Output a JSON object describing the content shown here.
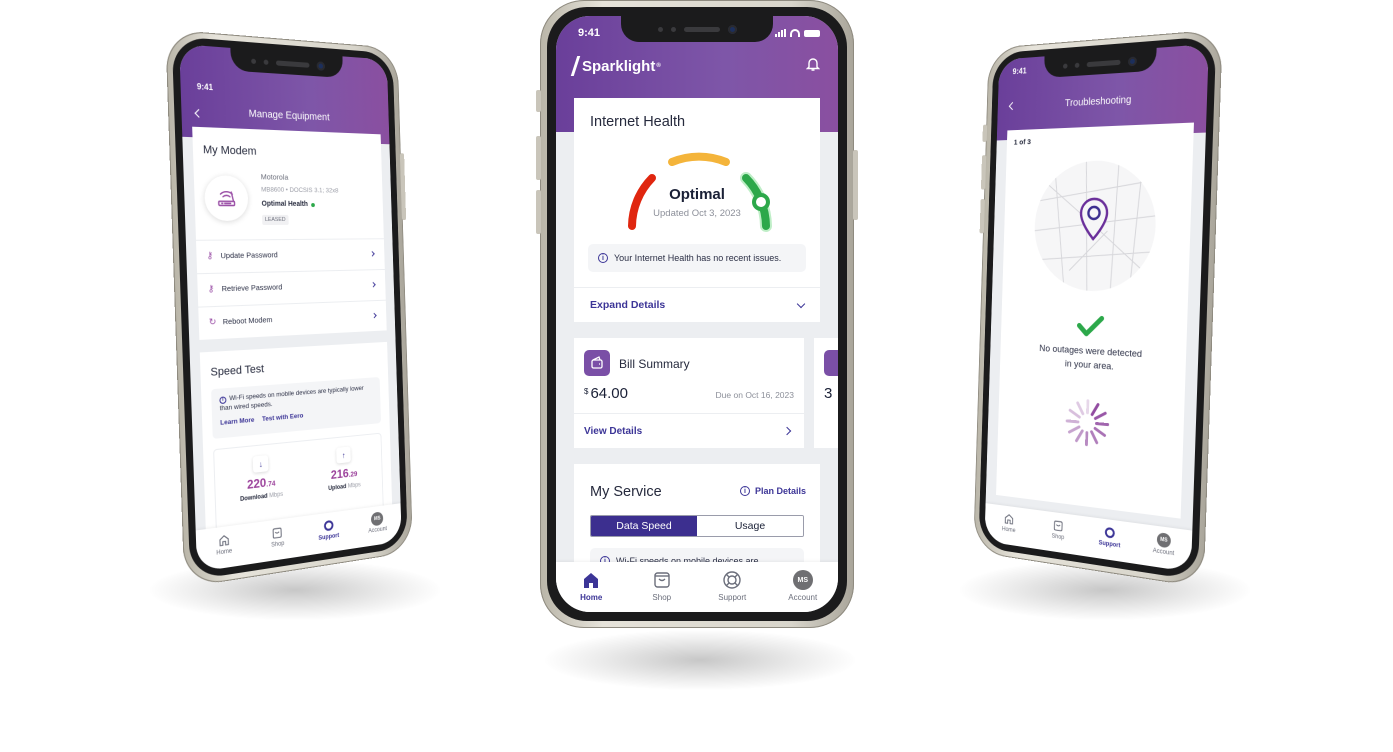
{
  "status_bar": {
    "time": "9:41"
  },
  "center_phone": {
    "brand": "Sparklight",
    "brand_mark": "®",
    "internet_health": {
      "title": "Internet Health",
      "status": "Optimal",
      "updated": "Updated Oct 3, 2023",
      "gauge_level": "optimal",
      "notice": "Your Internet Health has no recent issues.",
      "expand_label": "Expand Details"
    },
    "bill_summary": {
      "title": "Bill Summary",
      "currency": "$",
      "amount": "64.00",
      "due": "Due on Oct 16, 2023",
      "view_label": "View Details"
    },
    "next_card_partial": {
      "value": "3"
    },
    "my_service": {
      "title": "My Service",
      "plan_link": "Plan Details",
      "tabs": [
        {
          "label": "Data Speed",
          "active": true
        },
        {
          "label": "Usage",
          "active": false
        }
      ],
      "notice": "Wi-Fi speeds on mobile devices are"
    },
    "tabbar": [
      {
        "label": "Home",
        "icon": "home-icon",
        "active": true
      },
      {
        "label": "Shop",
        "icon": "shopping-bag-icon",
        "active": false
      },
      {
        "label": "Support",
        "icon": "lifebuoy-icon",
        "active": false
      },
      {
        "label": "Account",
        "icon": "avatar",
        "initials": "MS",
        "active": false
      }
    ]
  },
  "left_phone": {
    "title": "Manage Equipment",
    "modem": {
      "title": "My Modem",
      "brand": "Motorola",
      "model": "MB8600 • DOCSIS 3.1; 32x8",
      "health": "Optimal Health",
      "badge": "LEASED"
    },
    "actions": [
      {
        "label": "Update Password",
        "icon": "key-icon"
      },
      {
        "label": "Retrieve Password",
        "icon": "key-icon"
      },
      {
        "label": "Reboot Modem",
        "icon": "refresh-icon"
      }
    ],
    "speed_test": {
      "title": "Speed Test",
      "notice": "Wi-Fi speeds on mobile devices are typically lower than wired speeds.",
      "learn_more": "Learn More",
      "test_eero": "Test with Eero",
      "download": {
        "whole": "220",
        "decimal": ".74",
        "label": "Download",
        "unit": "Mbps"
      },
      "upload": {
        "whole": "216",
        "decimal": ".29",
        "label": "Upload",
        "unit": "Mbps"
      }
    },
    "tabbar": [
      {
        "label": "Home",
        "active": false
      },
      {
        "label": "Shop",
        "active": false
      },
      {
        "label": "Support",
        "active": true
      },
      {
        "label": "Account",
        "initials": "MS",
        "active": false
      }
    ]
  },
  "right_phone": {
    "title": "Troubleshooting",
    "step": "1 of 3",
    "message": "No outages were detected in your area.",
    "message_line1": "No outages were detected",
    "message_line2": "in your area.",
    "tabbar": [
      {
        "label": "Home",
        "active": false
      },
      {
        "label": "Shop",
        "active": false
      },
      {
        "label": "Support",
        "active": true
      },
      {
        "label": "Account",
        "initials": "MS",
        "active": false
      }
    ]
  },
  "colors": {
    "brand_purple": "#7e56a8",
    "accent_indigo": "#3c3597",
    "gauge_red": "#e0260f",
    "gauge_yellow": "#f4b43a",
    "gauge_green": "#2ca84a"
  }
}
